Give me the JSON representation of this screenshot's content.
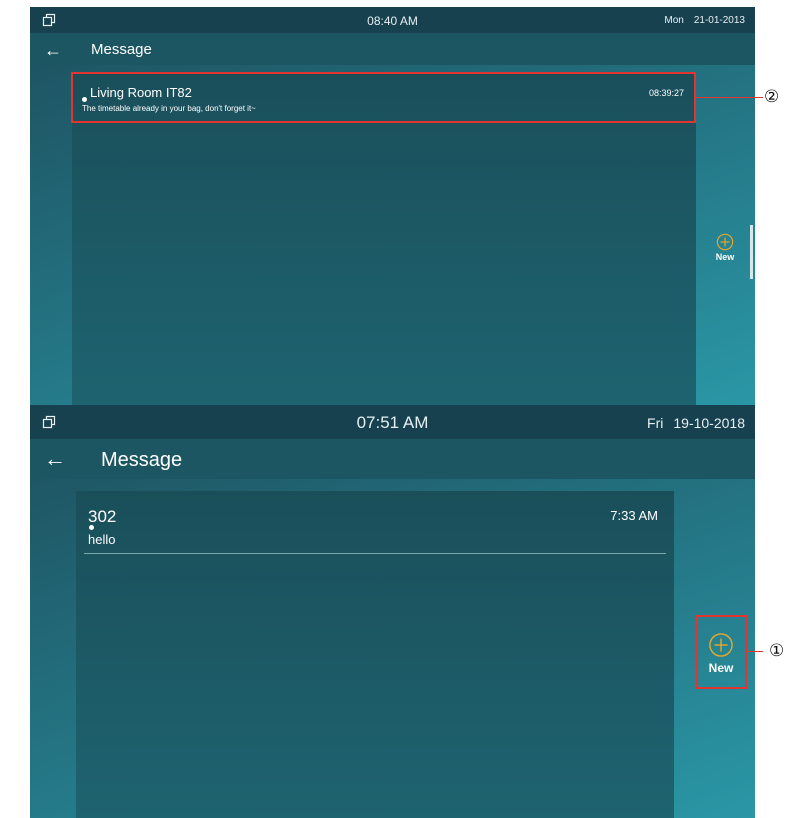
{
  "screens": [
    {
      "status": {
        "time": "08:40 AM",
        "day": "Mon",
        "date": "21-01-2013"
      },
      "title": "Message",
      "message": {
        "sender": "Living Room IT82",
        "body": "The timetable already in your bag, don't forget it~",
        "time": "08:39:27"
      },
      "new_label": "New"
    },
    {
      "status": {
        "time": "07:51 AM",
        "day": "Fri",
        "date": "19-10-2018"
      },
      "title": "Message",
      "message": {
        "sender": "302",
        "body": "hello",
        "time": "7:33 AM"
      },
      "new_label": "New"
    }
  ],
  "callouts": {
    "message_item": "②",
    "new_button": "①"
  },
  "colors": {
    "statusbar": "#17414f",
    "titlebar": "#1c5663",
    "accent": "#e5a72b",
    "highlight": "#e3342f"
  },
  "icons": {
    "status": "window-restore-icon",
    "back": "back-arrow-icon",
    "new": "plus-circle-icon"
  }
}
